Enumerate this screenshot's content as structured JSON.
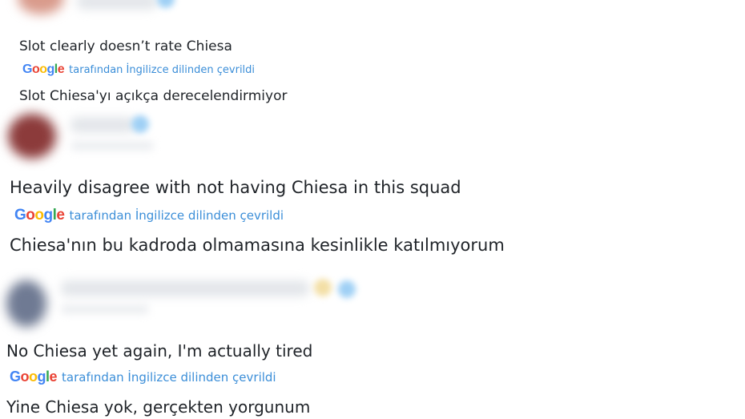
{
  "colors": {
    "text": "#1f2328",
    "translation_link": "#3b8ed8",
    "google_blue": "#4285f4",
    "google_red": "#ea4335",
    "google_yellow": "#fbbc05",
    "google_green": "#34a853"
  },
  "translation_badge": {
    "logo_letters": [
      "G",
      "o",
      "o",
      "g",
      "l",
      "e"
    ],
    "label": "tarafından İngilizce dilinden çevrildi"
  },
  "posts": [
    {
      "original": "Slot clearly doesn’t rate Chiesa",
      "translation": "Slot Chiesa'yı açıkça derecelendirmiyor"
    },
    {
      "original": "Heavily disagree with not having Chiesa in this squad",
      "translation": "Chiesa'nın bu kadroda olmamasına kesinlikle katılmıyorum"
    },
    {
      "original": "No Chiesa yet again, I'm actually tired",
      "translation": "Yine Chiesa yok, gerçekten yorgunum"
    }
  ]
}
